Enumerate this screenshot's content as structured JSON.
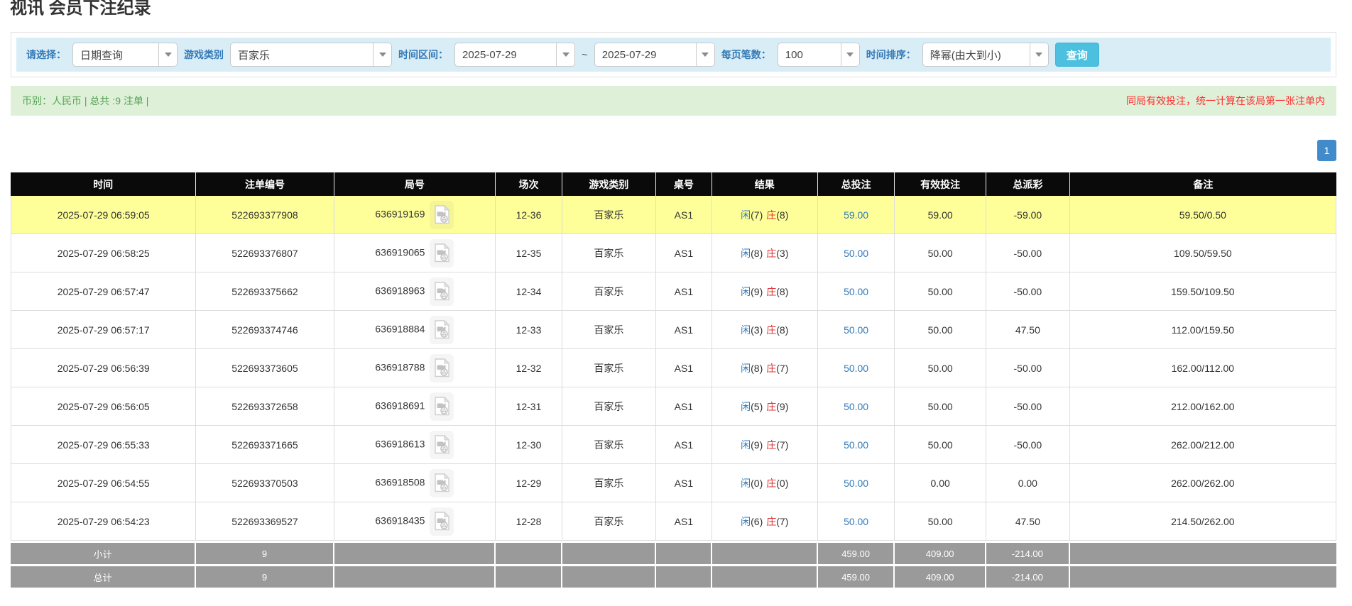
{
  "page": {
    "title": "视讯 会员下注纪录"
  },
  "filters": {
    "query_type_label": "请选择：",
    "query_type_value": "日期查询",
    "game_type_label": "游戏类别",
    "game_type_value": "百家乐",
    "time_range_label": "时间区间：",
    "time_from": "2025-07-29",
    "time_separator": "~",
    "time_to": "2025-07-29",
    "page_size_label": "每页笔数：",
    "page_size_value": "100",
    "sort_label": "时间排序：",
    "sort_value": "降幂(由大到小)",
    "search_button": "查询"
  },
  "summary": {
    "left_text": "币别：人民币 | 总共 :9 注单 |",
    "right_note": "同局有效投注，统一计算在该局第一张注单内"
  },
  "pagination": {
    "current_page": "1"
  },
  "table": {
    "headers": [
      "时间",
      "注单编号",
      "局号",
      "场次",
      "游戏类别",
      "桌号",
      "结果",
      "总投注",
      "有效投注",
      "总派彩",
      "备注"
    ],
    "rows": [
      {
        "highlight": true,
        "time": "2025-07-29 06:59:05",
        "bet_id": "522693377908",
        "round_id": "636919169",
        "session": "12-36",
        "game": "百家乐",
        "table_no": "AS1",
        "result": {
          "player_label": "闲",
          "player_score": "(7)",
          "banker_label": "庄",
          "banker_score": "(8)"
        },
        "total_bet": "59.00",
        "valid_bet": "59.00",
        "payout": "-59.00",
        "remark": "59.50/0.50"
      },
      {
        "highlight": false,
        "time": "2025-07-29 06:58:25",
        "bet_id": "522693376807",
        "round_id": "636919065",
        "session": "12-35",
        "game": "百家乐",
        "table_no": "AS1",
        "result": {
          "player_label": "闲",
          "player_score": "(8)",
          "banker_label": "庄",
          "banker_score": "(3)"
        },
        "total_bet": "50.00",
        "valid_bet": "50.00",
        "payout": "-50.00",
        "remark": "109.50/59.50"
      },
      {
        "highlight": false,
        "time": "2025-07-29 06:57:47",
        "bet_id": "522693375662",
        "round_id": "636918963",
        "session": "12-34",
        "game": "百家乐",
        "table_no": "AS1",
        "result": {
          "player_label": "闲",
          "player_score": "(9)",
          "banker_label": "庄",
          "banker_score": "(8)"
        },
        "total_bet": "50.00",
        "valid_bet": "50.00",
        "payout": "-50.00",
        "remark": "159.50/109.50"
      },
      {
        "highlight": false,
        "time": "2025-07-29 06:57:17",
        "bet_id": "522693374746",
        "round_id": "636918884",
        "session": "12-33",
        "game": "百家乐",
        "table_no": "AS1",
        "result": {
          "player_label": "闲",
          "player_score": "(3)",
          "banker_label": "庄",
          "banker_score": "(8)"
        },
        "total_bet": "50.00",
        "valid_bet": "50.00",
        "payout": "47.50",
        "remark": "112.00/159.50"
      },
      {
        "highlight": false,
        "time": "2025-07-29 06:56:39",
        "bet_id": "522693373605",
        "round_id": "636918788",
        "session": "12-32",
        "game": "百家乐",
        "table_no": "AS1",
        "result": {
          "player_label": "闲",
          "player_score": "(8)",
          "banker_label": "庄",
          "banker_score": "(7)"
        },
        "total_bet": "50.00",
        "valid_bet": "50.00",
        "payout": "-50.00",
        "remark": "162.00/112.00"
      },
      {
        "highlight": false,
        "time": "2025-07-29 06:56:05",
        "bet_id": "522693372658",
        "round_id": "636918691",
        "session": "12-31",
        "game": "百家乐",
        "table_no": "AS1",
        "result": {
          "player_label": "闲",
          "player_score": "(5)",
          "banker_label": "庄",
          "banker_score": "(9)"
        },
        "total_bet": "50.00",
        "valid_bet": "50.00",
        "payout": "-50.00",
        "remark": "212.00/162.00"
      },
      {
        "highlight": false,
        "time": "2025-07-29 06:55:33",
        "bet_id": "522693371665",
        "round_id": "636918613",
        "session": "12-30",
        "game": "百家乐",
        "table_no": "AS1",
        "result": {
          "player_label": "闲",
          "player_score": "(9)",
          "banker_label": "庄",
          "banker_score": "(7)"
        },
        "total_bet": "50.00",
        "valid_bet": "50.00",
        "payout": "-50.00",
        "remark": "262.00/212.00"
      },
      {
        "highlight": false,
        "time": "2025-07-29 06:54:55",
        "bet_id": "522693370503",
        "round_id": "636918508",
        "session": "12-29",
        "game": "百家乐",
        "table_no": "AS1",
        "result": {
          "player_label": "闲",
          "player_score": "(0)",
          "banker_label": "庄",
          "banker_score": "(0)"
        },
        "total_bet": "50.00",
        "valid_bet": "0.00",
        "payout": "0.00",
        "remark": "262.00/262.00"
      },
      {
        "highlight": false,
        "time": "2025-07-29 06:54:23",
        "bet_id": "522693369527",
        "round_id": "636918435",
        "session": "12-28",
        "game": "百家乐",
        "table_no": "AS1",
        "result": {
          "player_label": "闲",
          "player_score": "(6)",
          "banker_label": "庄",
          "banker_score": "(7)"
        },
        "total_bet": "50.00",
        "valid_bet": "50.00",
        "payout": "47.50",
        "remark": "214.50/262.00"
      }
    ],
    "subtotal": {
      "label": "小计",
      "count": "9",
      "total_bet": "459.00",
      "valid_bet": "409.00",
      "payout": "-214.00"
    },
    "total": {
      "label": "总计",
      "count": "9",
      "total_bet": "459.00",
      "valid_bet": "409.00",
      "payout": "-214.00"
    }
  },
  "colors": {
    "filter_bar_bg": "#d9edf7",
    "label_blue": "#337ab7",
    "search_button_cyan": "#4cc0de",
    "summary_bg_green": "#dff0d8",
    "summary_text_green": "#54a254",
    "note_red": "#ff2f2f",
    "pager_blue": "#428bca",
    "header_bg_black": "#0a0a0a",
    "highlight_yellow": "#ffff99",
    "amount_link_blue": "#337ab7",
    "player_blue": "#337ab7",
    "banker_red": "#e03131",
    "negative_red": "#ff0000",
    "totals_gray": "#9a9a9a"
  }
}
